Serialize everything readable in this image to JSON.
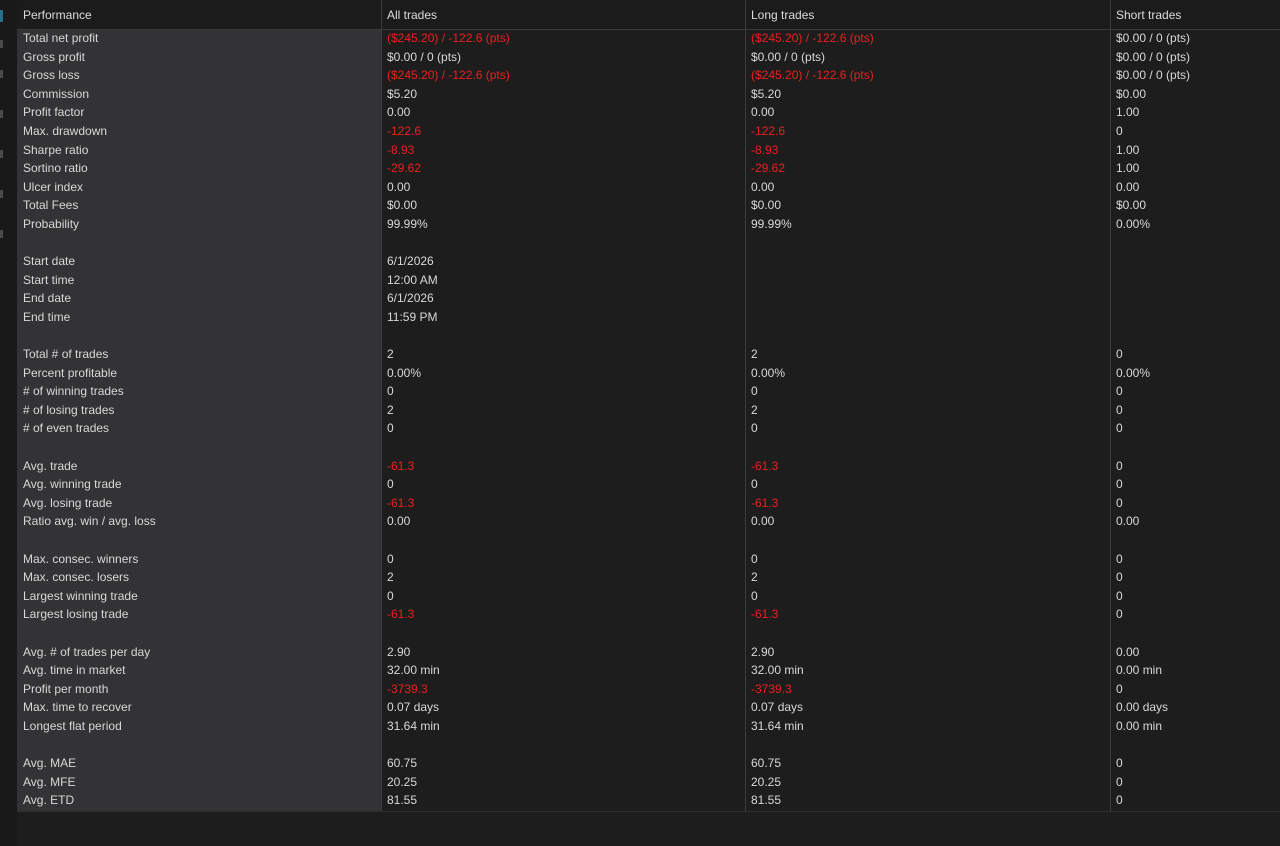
{
  "headers": [
    "Performance",
    "All trades",
    "Long trades",
    "Short trades"
  ],
  "colors": {
    "negative": "#e8211f",
    "text": "#d8d8d8",
    "label_bg": "#333335",
    "bg": "#1d1d1e"
  },
  "rows": [
    [
      "Total net profit",
      "($245.20) / -122.6 (pts)",
      "($245.20) / -122.6 (pts)",
      "$0.00 / 0 (pts)"
    ],
    [
      "Gross profit",
      "$0.00 / 0 (pts)",
      "$0.00 / 0 (pts)",
      "$0.00 / 0 (pts)"
    ],
    [
      "Gross loss",
      "($245.20) / -122.6 (pts)",
      "($245.20) / -122.6 (pts)",
      "$0.00 / 0 (pts)"
    ],
    [
      "Commission",
      "$5.20",
      "$5.20",
      "$0.00"
    ],
    [
      "Profit factor",
      "0.00",
      "0.00",
      "1.00"
    ],
    [
      "Max. drawdown",
      "-122.6",
      "-122.6",
      "0"
    ],
    [
      "Sharpe ratio",
      "-8.93",
      "-8.93",
      "1.00"
    ],
    [
      "Sortino ratio",
      "-29.62",
      "-29.62",
      "1.00"
    ],
    [
      "Ulcer index",
      "0.00",
      "0.00",
      "0.00"
    ],
    [
      "Total Fees",
      "$0.00",
      "$0.00",
      "$0.00"
    ],
    [
      "Probability",
      "99.99%",
      "99.99%",
      "0.00%"
    ],
    [
      "",
      "",
      "",
      ""
    ],
    [
      "Start date",
      "6/1/2026",
      "",
      ""
    ],
    [
      "Start time",
      "12:00 AM",
      "",
      ""
    ],
    [
      "End date",
      "6/1/2026",
      "",
      ""
    ],
    [
      "End time",
      "11:59 PM",
      "",
      ""
    ],
    [
      "",
      "",
      "",
      ""
    ],
    [
      "Total # of trades",
      "2",
      "2",
      "0"
    ],
    [
      "Percent profitable",
      "0.00%",
      "0.00%",
      "0.00%"
    ],
    [
      "# of winning trades",
      "0",
      "0",
      "0"
    ],
    [
      "# of losing trades",
      "2",
      "2",
      "0"
    ],
    [
      "# of even trades",
      "0",
      "0",
      "0"
    ],
    [
      "",
      "",
      "",
      ""
    ],
    [
      "Avg. trade",
      "-61.3",
      "-61.3",
      "0"
    ],
    [
      "Avg. winning trade",
      "0",
      "0",
      "0"
    ],
    [
      "Avg. losing trade",
      "-61.3",
      "-61.3",
      "0"
    ],
    [
      "Ratio avg. win / avg. loss",
      "0.00",
      "0.00",
      "0.00"
    ],
    [
      "",
      "",
      "",
      ""
    ],
    [
      "Max. consec. winners",
      "0",
      "0",
      "0"
    ],
    [
      "Max. consec. losers",
      "2",
      "2",
      "0"
    ],
    [
      "Largest winning trade",
      "0",
      "0",
      "0"
    ],
    [
      "Largest losing trade",
      "-61.3",
      "-61.3",
      "0"
    ],
    [
      "",
      "",
      "",
      ""
    ],
    [
      "Avg. # of trades per day",
      "2.90",
      "2.90",
      "0.00"
    ],
    [
      "Avg. time in market",
      "32.00 min",
      "32.00 min",
      "0.00 min"
    ],
    [
      "Profit per month",
      "-3739.3",
      "-3739.3",
      "0"
    ],
    [
      "Max. time to recover",
      "0.07 days",
      "0.07 days",
      "0.00 days"
    ],
    [
      "Longest flat period",
      "31.64 min",
      "31.64 min",
      "0.00 min"
    ],
    [
      "",
      "",
      "",
      ""
    ],
    [
      "Avg. MAE",
      "60.75",
      "60.75",
      "0"
    ],
    [
      "Avg. MFE",
      "20.25",
      "20.25",
      "0"
    ],
    [
      "Avg. ETD",
      "81.55",
      "81.55",
      "0"
    ]
  ]
}
